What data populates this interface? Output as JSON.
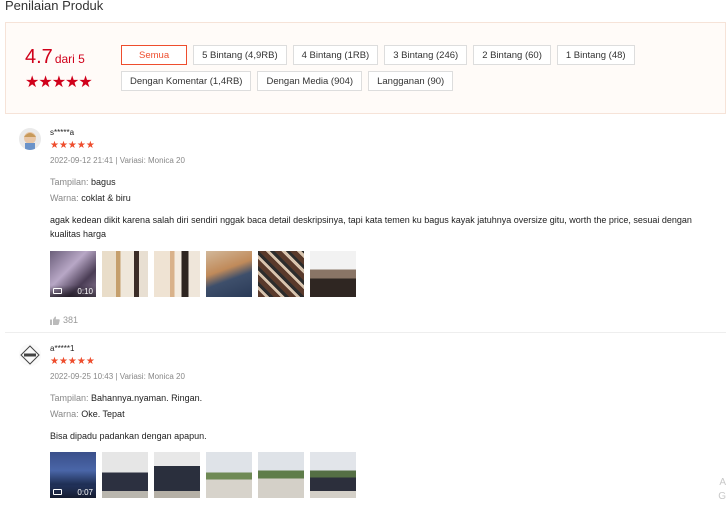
{
  "page_title": "Penilaian Produk",
  "rating": {
    "value": "4.7",
    "suffix": "dari 5",
    "stars": "★★★★★"
  },
  "filters": [
    {
      "label": "Semua",
      "active": true
    },
    {
      "label": "5 Bintang (4,9RB)"
    },
    {
      "label": "4 Bintang (1RB)"
    },
    {
      "label": "3 Bintang (246)"
    },
    {
      "label": "2 Bintang (60)"
    },
    {
      "label": "1 Bintang (48)"
    },
    {
      "label": "Dengan Komentar (1,4RB)"
    },
    {
      "label": "Dengan Media (904)"
    },
    {
      "label": "Langganan (90)"
    }
  ],
  "reviews": [
    {
      "username": "s*****a",
      "stars": "★★★★★",
      "date": "2022-09-12 21:41",
      "variation": "Variasi: Monica 20",
      "attr1_key": "Tampilan:",
      "attr1_val": "bagus",
      "attr2_key": "Warna:",
      "attr2_val": "coklat & biru",
      "comment": "agak kedean dikit karena salah diri sendiri nggak baca detail deskripsinya, tapi kata temen ku bagus kayak jatuhnya oversize gitu, worth the price, sesuai dengan kualitas harga",
      "video_duration": "0:10",
      "likes": "381"
    },
    {
      "username": "a*****1",
      "stars": "★★★★★",
      "date": "2022-09-25 10:43",
      "variation": "Variasi: Monica 20",
      "attr1_key": "Tampilan:",
      "attr1_val": "Bahannya.nyaman. Ringan.",
      "attr2_key": "Warna:",
      "attr2_val": "Oke. Tepat",
      "comment": "Bisa dipadu padankan dengan apapun.",
      "video_duration": "0:07"
    }
  ],
  "side_text": {
    "line1": "A",
    "line2": "G"
  }
}
